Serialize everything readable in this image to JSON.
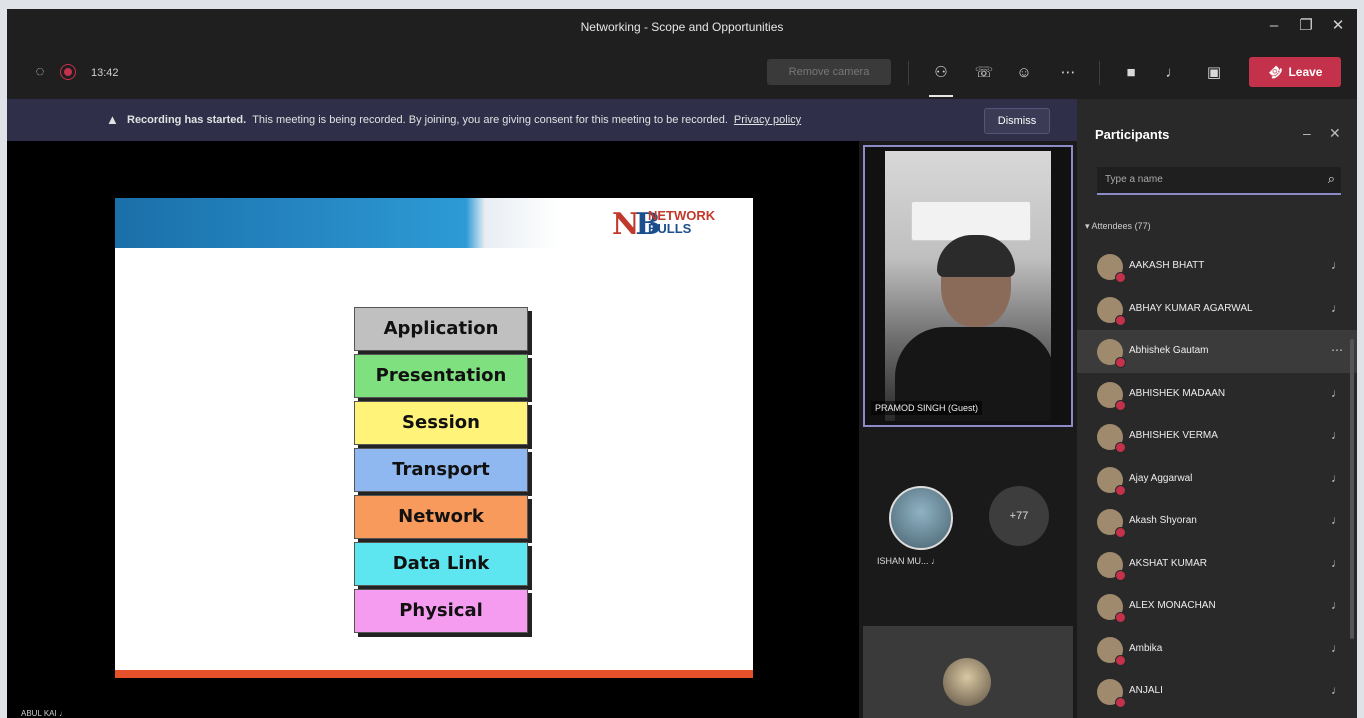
{
  "window": {
    "title": "Networking - Scope and Opportunities"
  },
  "toolbar": {
    "timer": "13:42",
    "remove_label": "Remove camera",
    "leave_label": "Leave"
  },
  "banner": {
    "bold": "Recording has started.",
    "message": "This meeting is being recorded. By joining, you are giving consent for this meeting to be recorded.",
    "link": "Privacy policy",
    "dismiss": "Dismiss"
  },
  "slide": {
    "logo_line1": "NETWORK",
    "logo_line2": "BULLS",
    "layers": [
      {
        "label": "Application",
        "color": "#c0c0c0"
      },
      {
        "label": "Presentation",
        "color": "#7fe07f"
      },
      {
        "label": "Session",
        "color": "#fff37a"
      },
      {
        "label": "Transport",
        "color": "#8fb8f0"
      },
      {
        "label": "Network",
        "color": "#f79a5b"
      },
      {
        "label": "Data Link",
        "color": "#5ee6f0"
      },
      {
        "label": "Physical",
        "color": "#f59cf0"
      }
    ]
  },
  "videos": {
    "main_name": "PRAMOD SINGH (Guest)",
    "mini_name": "ISHAN MU...",
    "more": "+77",
    "self_name": "ABUL KAI"
  },
  "panel": {
    "title": "Participants",
    "search_placeholder": "Type a name",
    "section": "Attendees (77)",
    "participants": [
      "AAKASH BHATT",
      "ABHAY KUMAR AGARWAL",
      "Abhishek Gautam",
      "ABHISHEK MADAAN",
      "ABHISHEK VERMA",
      "Ajay Aggarwal",
      "Akash Shyoran",
      "AKSHAT KUMAR",
      "ALEX MONACHAN",
      "Ambika",
      "ANJALI"
    ]
  },
  "colors": {
    "accent": "#8b8cc7",
    "leave": "#c4314b",
    "banner": "#2f2f4a"
  }
}
